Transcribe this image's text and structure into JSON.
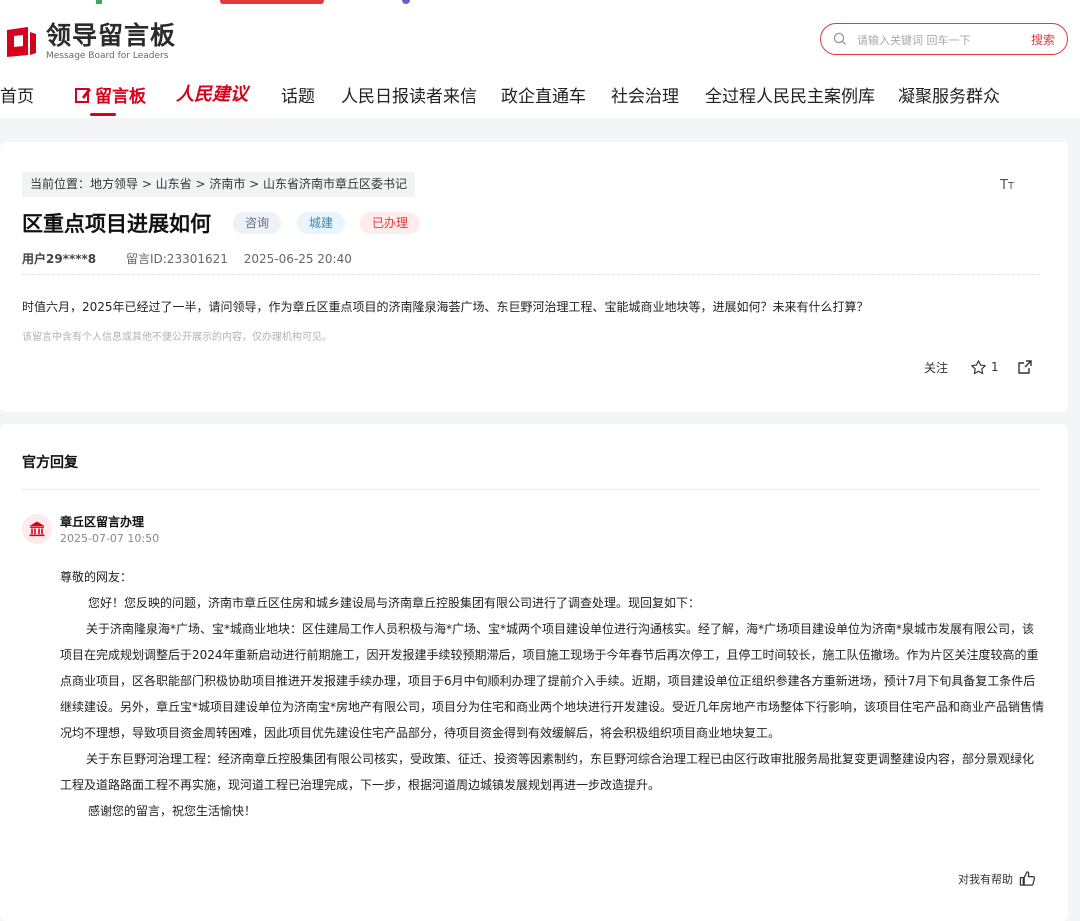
{
  "header": {
    "logo_cn": "领导留言板",
    "logo_en": "Message Board for Leaders",
    "search_placeholder": "请输入关键词 回车一下",
    "search_button": "搜索"
  },
  "nav": {
    "items": [
      {
        "label": "首页"
      },
      {
        "label": "留言板"
      },
      {
        "label": "人民建议"
      },
      {
        "label": "话题"
      },
      {
        "label": "人民日报读者来信"
      },
      {
        "label": "政企直通车"
      },
      {
        "label": "社会治理"
      },
      {
        "label": "全过程人民民主案例库"
      },
      {
        "label": "凝聚服务群众"
      }
    ]
  },
  "message": {
    "breadcrumb": "当前位置：地方领导 > 山东省 > 济南市 > 山东省济南市章丘区委书记",
    "textsize_icon_label": "TT",
    "title": "区重点项目进展如何",
    "tags": [
      "咨询",
      "城建",
      "已办理"
    ],
    "user": "用户29****8",
    "message_id": "留言ID:23301621",
    "datetime": "2025-06-25 20:40",
    "content": "时值六月，2025年已经过了一半，请问领导，作为章丘区重点项目的济南隆泉海荟广场、东巨野河治理工程、宝能城商业地块等，进展如何？未来有什么打算？",
    "privacy_note": "该留言中含有个人信息或其他不便公开展示的内容，仅办理机构可见。",
    "follow_label": "关注",
    "star_count": "1"
  },
  "reply": {
    "heading": "官方回复",
    "org_name": "章丘区留言办理",
    "org_date": "2025-07-07 10:50",
    "greeting": "尊敬的网友：",
    "para1": "您好！您反映的问题，济南市章丘区住房和城乡建设局与济南章丘控股集团有限公司进行了调查处理。现回复如下：",
    "para2": "关于济南隆泉海*广场、宝*城商业地块：区住建局工作人员积极与海*广场、宝*城两个项目建设单位进行沟通核实。经了解，海*广场项目建设单位为济南*泉城市发展有限公司，该项目在完成规划调整后于2024年重新启动进行前期施工，因开发报建手续较预期滞后，项目施工现场于今年春节后再次停工，且停工时间较长，施工队伍撤场。作为片区关注度较高的重点商业项目，区各职能部门积极协助项目推进开发报建手续办理，项目于6月中旬顺利办理了提前介入手续。近期，项目建设单位正组织参建各方重新进场，预计7月下旬具备复工条件后继续建设。另外，章丘宝*城项目建设单位为济南宝*房地产有限公司，项目分为住宅和商业两个地块进行开发建设。受近几年房地产市场整体下行影响，该项目住宅产品和商业产品销售情况均不理想，导致项目资金周转困难，因此项目优先建设住宅产品部分，待项目资金得到有效缓解后，将会积极组织项目商业地块复工。",
    "para3": "关于东巨野河治理工程：经济南章丘控股集团有限公司核实，受政策、征迁、投资等因素制约，东巨野河综合治理工程已由区行政审批服务局批复变更调整建设内容，部分景观绿化工程及道路路面工程不再实施，现河道工程已治理完成，下一步，根据河道周边城镇发展规划再进一步改造提升。",
    "closing": "感谢您的留言，祝您生活愉快！",
    "helpful_label": "对我有帮助"
  },
  "colors": {
    "brand_red": "#d9001b",
    "search_red": "#e4393c"
  }
}
